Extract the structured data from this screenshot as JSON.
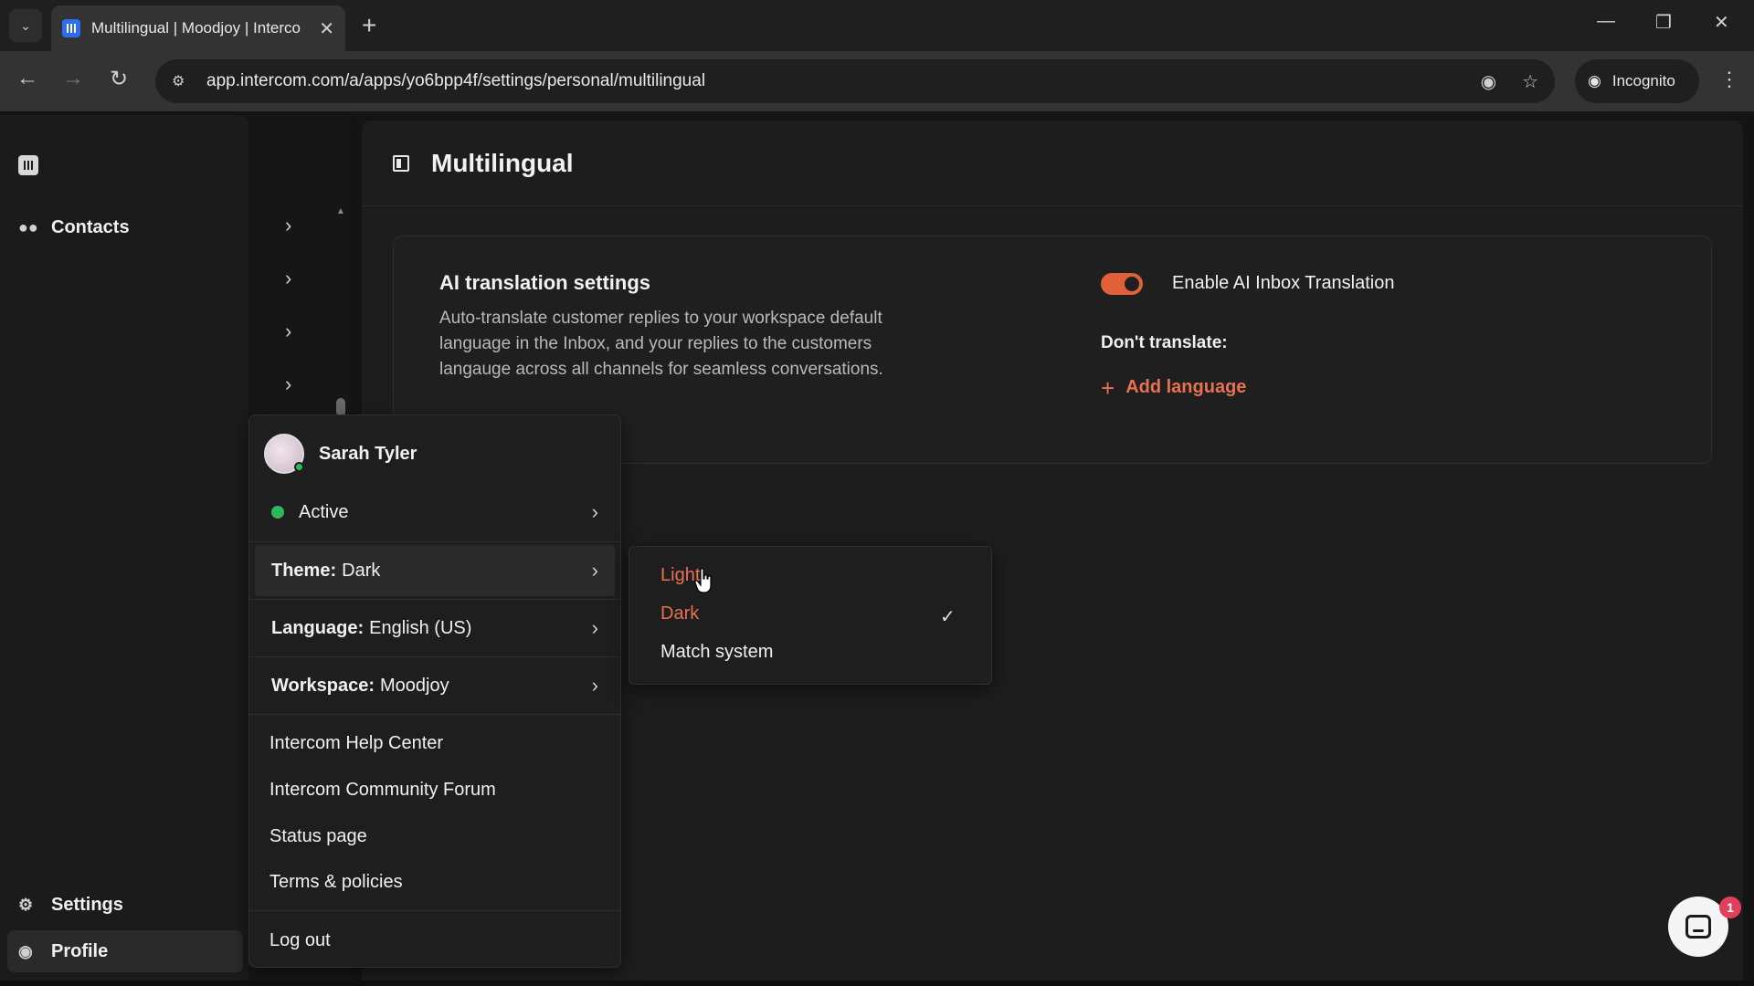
{
  "browser": {
    "tab_title": "Multilingual | Moodjoy | Interco",
    "url": "app.intercom.com/a/apps/yo6bpp4f/settings/personal/multilingual",
    "incognito_label": "Incognito"
  },
  "leftnav": {
    "contacts_label": "Contacts",
    "settings_label": "Settings",
    "profile_label": "Profile"
  },
  "main": {
    "title": "Multilingual",
    "card": {
      "heading": "AI translation settings",
      "description": "Auto-translate customer replies to your workspace default language in the Inbox, and your replies to the customers langauge across all channels for seamless conversations.",
      "toggle_label": "Enable AI Inbox Translation",
      "toggle_on": true,
      "dont_translate_label": "Don't translate:",
      "add_language_label": "Add language"
    }
  },
  "profile_menu": {
    "user_name": "Sarah Tyler",
    "status_label": "Active",
    "theme_key": "Theme:",
    "theme_value": "Dark",
    "language_key": "Language:",
    "language_value": "English (US)",
    "workspace_key": "Workspace:",
    "workspace_value": "Moodjoy",
    "links": [
      "Intercom Help Center",
      "Intercom Community Forum",
      "Status page",
      "Terms & policies"
    ],
    "logout_label": "Log out"
  },
  "theme_submenu": {
    "options": [
      "Light",
      "Dark",
      "Match system"
    ],
    "selected": "Dark"
  },
  "messenger": {
    "badge_count": "1"
  },
  "colors": {
    "accent": "#e97050",
    "toggle": "#e0603a",
    "status_active": "#2eb85c"
  }
}
